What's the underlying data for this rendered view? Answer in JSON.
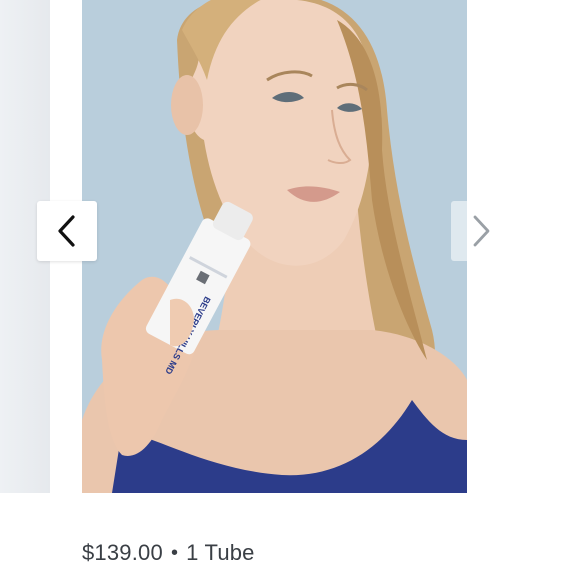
{
  "carousel": {
    "product_image": {
      "brand_text": "BEVERLY HILLS MD",
      "alt": "Woman holding a white tube of Beverly Hills MD skincare product"
    },
    "prev_icon": "chevron-left-icon",
    "next_icon": "chevron-right-icon"
  },
  "product": {
    "price": "$139.00",
    "separator": "•",
    "quantity": "1 Tube"
  },
  "colors": {
    "background": "#ffffff",
    "photo_backdrop": "#b7ccda",
    "tank_top": "#2c3c8a",
    "text": "#3a3f45"
  }
}
